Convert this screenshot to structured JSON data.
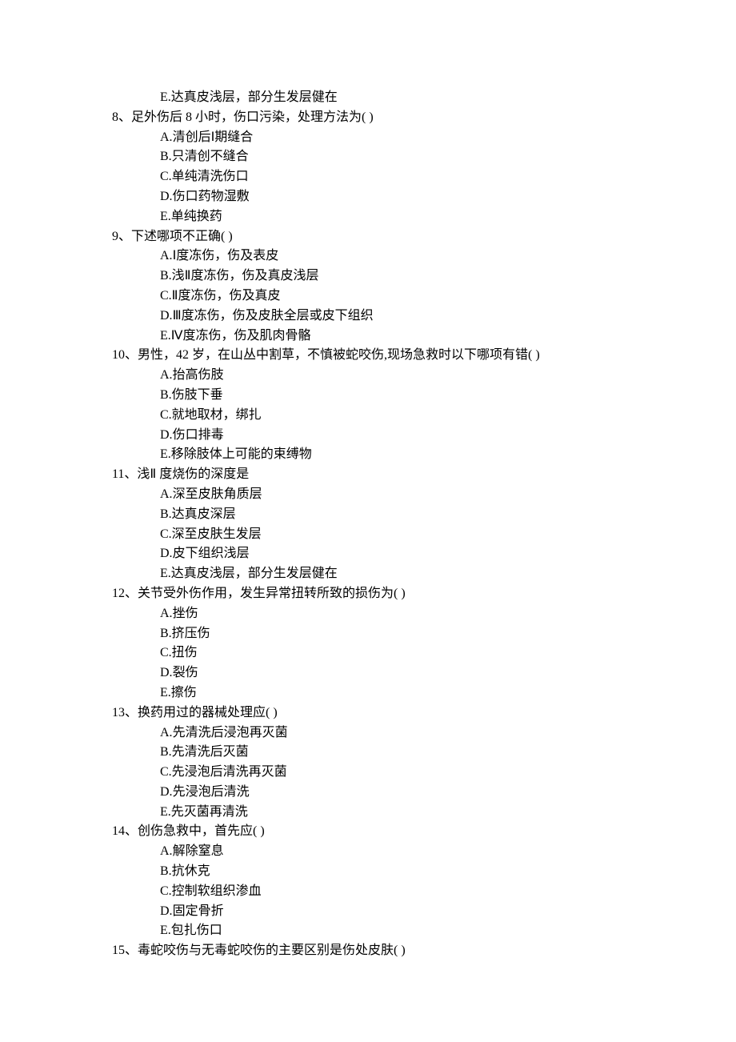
{
  "leading_option": {
    "label": "E.",
    "text": "达真皮浅层，部分生发层健在"
  },
  "questions": [
    {
      "number": "8、",
      "stem": "足外伤后 8 小时，伤口污染，处理方法为( )",
      "options": [
        {
          "label": "A.",
          "text": "清创后Ⅰ期缝合"
        },
        {
          "label": "B.",
          "text": "只清创不缝合"
        },
        {
          "label": "C.",
          "text": "单纯清洗伤口"
        },
        {
          "label": "D.",
          "text": "伤口药物湿敷"
        },
        {
          "label": "E.",
          "text": "单纯换药"
        }
      ]
    },
    {
      "number": "9、",
      "stem": "下述哪项不正确( )",
      "options": [
        {
          "label": "A.",
          "text": "Ⅰ度冻伤，伤及表皮"
        },
        {
          "label": "B.",
          "text": "浅Ⅱ度冻伤，伤及真皮浅层"
        },
        {
          "label": "C.",
          "text": "Ⅱ度冻伤，伤及真皮"
        },
        {
          "label": "D.",
          "text": "Ⅲ度冻伤，伤及皮肤全层或皮下组织"
        },
        {
          "label": "E.",
          "text": "Ⅳ度冻伤，伤及肌肉骨骼"
        }
      ]
    },
    {
      "number": "10、",
      "stem": "男性，42 岁，在山丛中割草，不慎被蛇咬伤,现场急救时以下哪项有错( )",
      "options": [
        {
          "label": "A.",
          "text": "抬高伤肢"
        },
        {
          "label": "B.",
          "text": "伤肢下垂"
        },
        {
          "label": "C.",
          "text": "就地取材，绑扎"
        },
        {
          "label": "D.",
          "text": "伤口排毒"
        },
        {
          "label": "E.",
          "text": "移除肢体上可能的束缚物"
        }
      ]
    },
    {
      "number": "11、",
      "stem": "浅Ⅱ 度烧伤的深度是",
      "options": [
        {
          "label": "A.",
          "text": "深至皮肤角质层"
        },
        {
          "label": "B.",
          "text": "达真皮深层"
        },
        {
          "label": "C.",
          "text": "深至皮肤生发层"
        },
        {
          "label": "D.",
          "text": "皮下组织浅层"
        },
        {
          "label": "E.",
          "text": "达真皮浅层，部分生发层健在"
        }
      ]
    },
    {
      "number": "12、",
      "stem": "关节受外伤作用，发生异常扭转所致的损伤为( )",
      "options": [
        {
          "label": "A.",
          "text": "挫伤"
        },
        {
          "label": "B.",
          "text": "挤压伤"
        },
        {
          "label": "C.",
          "text": "扭伤"
        },
        {
          "label": "D.",
          "text": "裂伤"
        },
        {
          "label": "E.",
          "text": "擦伤"
        }
      ]
    },
    {
      "number": "13、",
      "stem": "换药用过的器械处理应( )",
      "options": [
        {
          "label": "A.",
          "text": "先清洗后浸泡再灭菌"
        },
        {
          "label": "B.",
          "text": "先清洗后灭菌"
        },
        {
          "label": "C.",
          "text": "先浸泡后清洗再灭菌"
        },
        {
          "label": "D.",
          "text": "先浸泡后清洗"
        },
        {
          "label": "E.",
          "text": "先灭菌再清洗"
        }
      ]
    },
    {
      "number": "14、",
      "stem": "创伤急救中，首先应( )",
      "options": [
        {
          "label": "A.",
          "text": "解除窒息"
        },
        {
          "label": "B.",
          "text": "抗休克"
        },
        {
          "label": "C.",
          "text": "控制软组织渗血"
        },
        {
          "label": "D.",
          "text": "固定骨折"
        },
        {
          "label": "E.",
          "text": "包扎伤口"
        }
      ]
    },
    {
      "number": "15、",
      "stem": "毒蛇咬伤与无毒蛇咬伤的主要区别是伤处皮肤( )",
      "options": []
    }
  ]
}
